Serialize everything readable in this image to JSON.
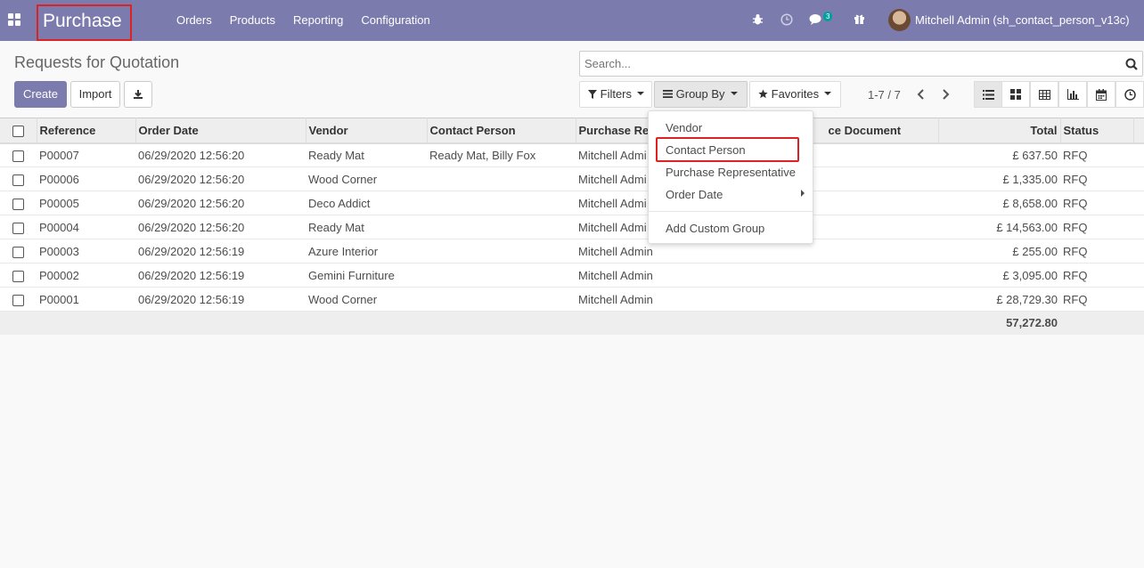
{
  "navbar": {
    "app_name": "Purchase",
    "menu": [
      "Orders",
      "Products",
      "Reporting",
      "Configuration"
    ],
    "messages_count": "3",
    "user": "Mitchell Admin (sh_contact_person_v13c)"
  },
  "page": {
    "title": "Requests for Quotation",
    "search_placeholder": "Search...",
    "buttons": {
      "create": "Create",
      "import": "Import"
    },
    "filters": {
      "filters": "Filters",
      "group_by": "Group By",
      "favorites": "Favorites"
    },
    "pager": "1-7 / 7"
  },
  "table": {
    "columns": [
      "Reference",
      "Order Date",
      "Vendor",
      "Contact Person",
      "Purchase Re",
      "ce Document",
      "Total",
      "Status"
    ],
    "rows": [
      {
        "ref": "P00007",
        "date": "06/29/2020 12:56:20",
        "vendor": "Ready Mat",
        "contact": "Ready Mat, Billy Fox",
        "rep": "Mitchell Admi",
        "total": "£ 637.50",
        "status": "RFQ"
      },
      {
        "ref": "P00006",
        "date": "06/29/2020 12:56:20",
        "vendor": "Wood Corner",
        "contact": "",
        "rep": "Mitchell Admi",
        "total": "£ 1,335.00",
        "status": "RFQ"
      },
      {
        "ref": "P00005",
        "date": "06/29/2020 12:56:20",
        "vendor": "Deco Addict",
        "contact": "",
        "rep": "Mitchell Admi",
        "total": "£ 8,658.00",
        "status": "RFQ"
      },
      {
        "ref": "P00004",
        "date": "06/29/2020 12:56:20",
        "vendor": "Ready Mat",
        "contact": "",
        "rep": "Mitchell Admi",
        "total": "£ 14,563.00",
        "status": "RFQ"
      },
      {
        "ref": "P00003",
        "date": "06/29/2020 12:56:19",
        "vendor": "Azure Interior",
        "contact": "",
        "rep": "Mitchell Admin",
        "total": "£ 255.00",
        "status": "RFQ"
      },
      {
        "ref": "P00002",
        "date": "06/29/2020 12:56:19",
        "vendor": "Gemini Furniture",
        "contact": "",
        "rep": "Mitchell Admin",
        "total": "£ 3,095.00",
        "status": "RFQ"
      },
      {
        "ref": "P00001",
        "date": "06/29/2020 12:56:19",
        "vendor": "Wood Corner",
        "contact": "",
        "rep": "Mitchell Admin",
        "total": "£ 28,729.30",
        "status": "RFQ"
      }
    ],
    "grand_total": "57,272.80"
  },
  "group_by_menu": {
    "items": [
      "Vendor",
      "Contact Person",
      "Purchase Representative",
      "Order Date"
    ],
    "custom": "Add Custom Group"
  },
  "colors": {
    "brand": "#7c7bad",
    "highlight": "#dd2222"
  },
  "icons": [
    "apps-icon",
    "bug-icon",
    "clock-icon",
    "chat-icon",
    "gift-icon",
    "search-icon",
    "download-icon",
    "filter-icon",
    "bars-icon",
    "star-icon",
    "chevron-left-icon",
    "chevron-right-icon",
    "list-view-icon",
    "kanban-view-icon",
    "pivot-view-icon",
    "graph-view-icon",
    "calendar-view-icon",
    "activity-view-icon"
  ]
}
